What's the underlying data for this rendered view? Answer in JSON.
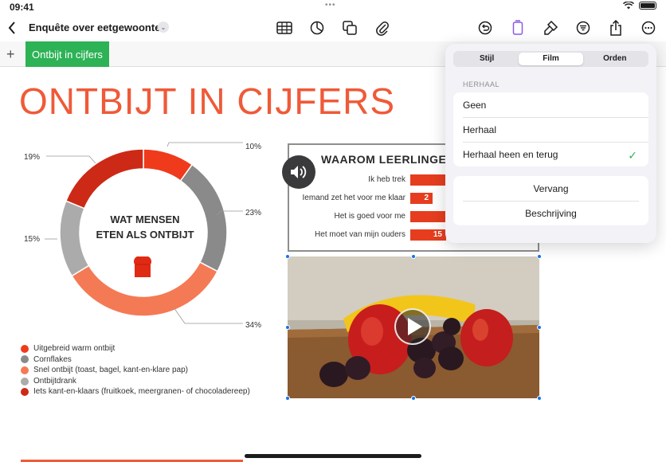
{
  "status": {
    "time": "09:41"
  },
  "toolbar": {
    "doc_title": "Enquête over eetgewoonten",
    "title_chevron": "⌄"
  },
  "sheet_tabs": [
    {
      "label": "Ontbijt in cijfers"
    }
  ],
  "slide": {
    "title": "ONTBIJT IN CIJFERS",
    "donut_center_line1": "WAT MENSEN",
    "donut_center_line2": "ETEN ALS ONTBIJT"
  },
  "chart_data": [
    {
      "type": "pie",
      "categories": [
        "Uitgebreid warm ontbijt",
        "Cornflakes",
        "Snel ontbijt (toast, bagel, kant-en-klare pap)",
        "Ontbijtdrank",
        "Iets kant-en-klaars (fruitkoek, meergranen- of chocoladereep)"
      ],
      "values": [
        10,
        23,
        34,
        15,
        19
      ],
      "labels": [
        "10%",
        "23%",
        "34%",
        "15%",
        "19%"
      ],
      "colors": [
        "#ef3b1c",
        "#8a8a8a",
        "#f47a55",
        "#ababab",
        "#cc2a16"
      ],
      "title": "WAT MENSEN ETEN ALS ONTBIJT",
      "legend": "bottom-left"
    },
    {
      "type": "bar",
      "title": "WAAROM LEERLINGEN",
      "categories": [
        "Ik heb trek",
        "Iemand zet het voor me klaar",
        "Het is goed voor me",
        "Het moet van mijn ouders"
      ],
      "values": [
        null,
        2,
        null,
        15
      ],
      "value_labels": [
        "",
        "2",
        "",
        "15"
      ],
      "color": "#e63d1f"
    }
  ],
  "popover": {
    "tabs": [
      "Stijl",
      "Film",
      "Orden"
    ],
    "active_tab": "Film",
    "section_label": "HERHAAL",
    "repeat_options": [
      "Geen",
      "Herhaal",
      "Herhaal heen en terug"
    ],
    "selected_option": "Herhaal heen en terug",
    "checkmark": "✓",
    "actions": [
      "Vervang",
      "Beschrijving"
    ]
  },
  "icons": [
    "back-chevron-icon",
    "table-icon",
    "chart-icon",
    "shape-icon",
    "attachment-icon",
    "undo-icon",
    "document-icon",
    "format-brush-icon",
    "filter-icon",
    "share-icon",
    "more-icon",
    "add-sheet-icon",
    "speaker-icon",
    "play-icon",
    "toast-icon"
  ]
}
